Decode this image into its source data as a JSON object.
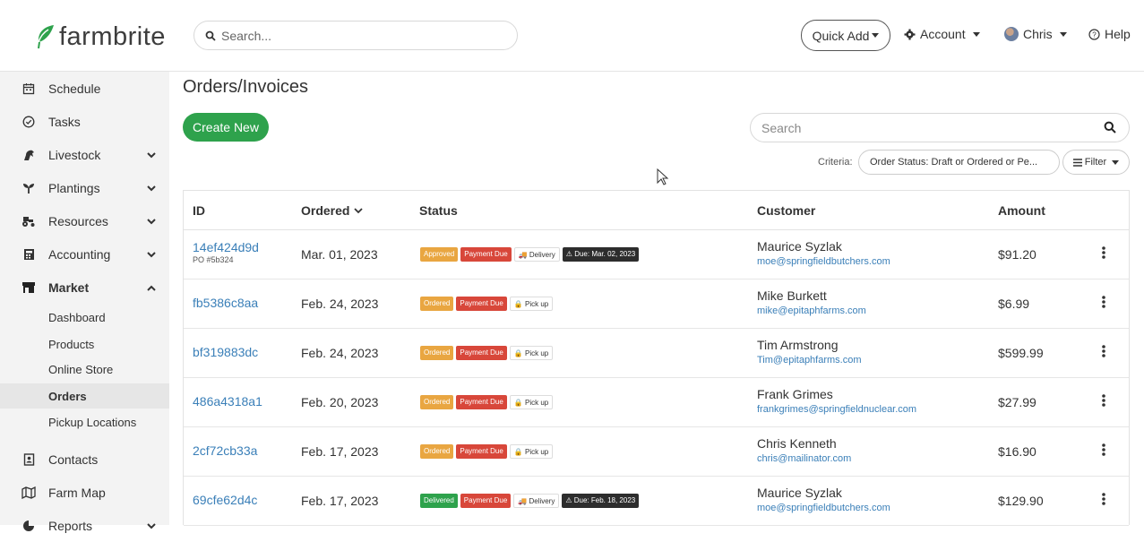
{
  "header": {
    "logo_text": "farmbrite",
    "search_placeholder": "Search...",
    "quick_add_label": "Quick Add",
    "account_label": "Account",
    "user_label": "Chris",
    "help_label": "Help"
  },
  "sidebar": {
    "items": [
      {
        "label": "Schedule",
        "icon": "calendar-icon"
      },
      {
        "label": "Tasks",
        "icon": "check-circle-icon"
      },
      {
        "label": "Livestock",
        "icon": "horse-icon"
      },
      {
        "label": "Plantings",
        "icon": "seedling-icon"
      },
      {
        "label": "Resources",
        "icon": "tractor-icon"
      },
      {
        "label": "Accounting",
        "icon": "calculator-icon"
      },
      {
        "label": "Market",
        "icon": "store-icon"
      },
      {
        "label": "Contacts",
        "icon": "address-book-icon"
      },
      {
        "label": "Farm Map",
        "icon": "map-icon"
      },
      {
        "label": "Reports",
        "icon": "chart-pie-icon"
      }
    ],
    "market_sub": [
      "Dashboard",
      "Products",
      "Online Store",
      "Orders",
      "Pickup Locations"
    ]
  },
  "main": {
    "title": "Orders/Invoices",
    "create_label": "Create New",
    "search_placeholder": "Search",
    "criteria_label": "Criteria:",
    "criteria_value": "Order Status: Draft or Ordered or Pe...",
    "filter_label": "Filter"
  },
  "table": {
    "headers": {
      "id": "ID",
      "ordered": "Ordered",
      "status": "Status",
      "customer": "Customer",
      "amount": "Amount"
    },
    "rows": [
      {
        "id": "14ef424d9d",
        "po": "PO #5b324",
        "date": "Mar. 01, 2023",
        "badges": [
          {
            "t": "Approved",
            "c": "b-approved"
          },
          {
            "t": "Payment Due",
            "c": "b-paydue"
          },
          {
            "t": "🚚 Delivery",
            "c": "b-plain"
          },
          {
            "t": "⚠ Due: Mar. 02, 2023",
            "c": "b-dark"
          }
        ],
        "customer": "Maurice Syzlak",
        "email": "moe@springfieldbutchers.com",
        "amount": "$91.20"
      },
      {
        "id": "fb5386c8aa",
        "po": "",
        "date": "Feb. 24, 2023",
        "badges": [
          {
            "t": "Ordered",
            "c": "b-ordered"
          },
          {
            "t": "Payment Due",
            "c": "b-paydue"
          },
          {
            "t": "🔒 Pick up",
            "c": "b-plain"
          }
        ],
        "customer": "Mike Burkett",
        "email": "mike@epitaphfarms.com",
        "amount": "$6.99"
      },
      {
        "id": "bf319883dc",
        "po": "",
        "date": "Feb. 24, 2023",
        "badges": [
          {
            "t": "Ordered",
            "c": "b-ordered"
          },
          {
            "t": "Payment Due",
            "c": "b-paydue"
          },
          {
            "t": "🔒 Pick up",
            "c": "b-plain"
          }
        ],
        "customer": "Tim Armstrong",
        "email": "Tim@epitaphfarms.com",
        "amount": "$599.99"
      },
      {
        "id": "486a4318a1",
        "po": "",
        "date": "Feb. 20, 2023",
        "badges": [
          {
            "t": "Ordered",
            "c": "b-ordered"
          },
          {
            "t": "Payment Due",
            "c": "b-paydue"
          },
          {
            "t": "🔒 Pick up",
            "c": "b-plain"
          }
        ],
        "customer": "Frank Grimes",
        "email": "frankgrimes@springfieldnuclear.com",
        "amount": "$27.99"
      },
      {
        "id": "2cf72cb33a",
        "po": "",
        "date": "Feb. 17, 2023",
        "badges": [
          {
            "t": "Ordered",
            "c": "b-ordered"
          },
          {
            "t": "Payment Due",
            "c": "b-paydue"
          },
          {
            "t": "🔒 Pick up",
            "c": "b-plain"
          }
        ],
        "customer": "Chris Kenneth",
        "email": "chris@mailinator.com",
        "amount": "$16.90"
      },
      {
        "id": "69cfe62d4c",
        "po": "",
        "date": "Feb. 17, 2023",
        "badges": [
          {
            "t": "Delivered",
            "c": "b-delivered"
          },
          {
            "t": "Payment Due",
            "c": "b-paydue"
          },
          {
            "t": "🚚 Delivery",
            "c": "b-plain"
          },
          {
            "t": "⚠ Due: Feb. 18, 2023",
            "c": "b-dark"
          }
        ],
        "customer": "Maurice Syzlak",
        "email": "moe@springfieldbutchers.com",
        "amount": "$129.90"
      }
    ]
  },
  "colors": {
    "brand_green": "#2ea24c",
    "link_blue": "#3a7fb8",
    "payment_due": "#d8473a",
    "ordered": "#e9a641"
  }
}
